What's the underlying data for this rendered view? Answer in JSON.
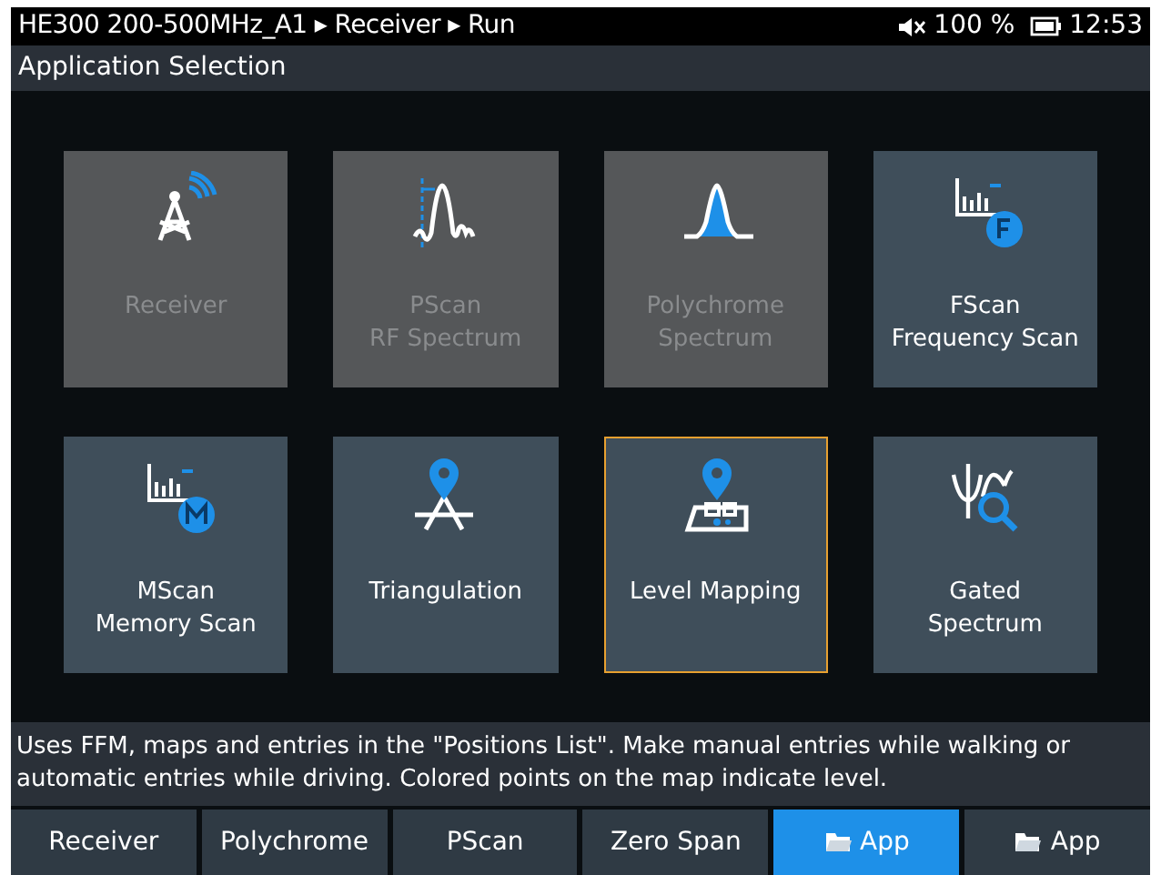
{
  "status_bar": {
    "path": "HE300 200-500MHz_A1 ▸ Receiver ▸ Run",
    "volume": "100 %",
    "time": "12:53"
  },
  "title": "Application Selection",
  "tiles": [
    {
      "kind": "tower",
      "lines": [
        "Receiver"
      ],
      "disabled": true,
      "selected": false
    },
    {
      "kind": "pscan",
      "lines": [
        "PScan",
        "RF Spectrum"
      ],
      "disabled": true,
      "selected": false
    },
    {
      "kind": "poly",
      "lines": [
        "Polychrome",
        "Spectrum"
      ],
      "disabled": true,
      "selected": false
    },
    {
      "kind": "fscan",
      "lines": [
        "FScan",
        "Frequency Scan"
      ],
      "disabled": false,
      "selected": false
    },
    {
      "kind": "mscan",
      "lines": [
        "MScan",
        "Memory Scan"
      ],
      "disabled": false,
      "selected": false
    },
    {
      "kind": "tri",
      "lines": [
        "Triangulation"
      ],
      "disabled": false,
      "selected": false
    },
    {
      "kind": "map",
      "lines": [
        "Level Mapping"
      ],
      "disabled": false,
      "selected": true
    },
    {
      "kind": "gated",
      "lines": [
        "Gated",
        "Spectrum"
      ],
      "disabled": false,
      "selected": false
    }
  ],
  "description": "Uses FFM, maps and entries in the \"Positions List\". Make manual entries while walking or automatic entries while driving. Colored points on the map indicate level.",
  "softkeys": [
    {
      "label": "Receiver",
      "kind": "plain",
      "selected": false
    },
    {
      "label": "Polychrome",
      "kind": "plain",
      "selected": false
    },
    {
      "label": "PScan",
      "kind": "plain",
      "selected": false
    },
    {
      "label": "Zero Span",
      "kind": "plain",
      "selected": false
    },
    {
      "label": "App",
      "kind": "folder",
      "selected": true
    },
    {
      "label": "App",
      "kind": "folder",
      "selected": false
    }
  ]
}
